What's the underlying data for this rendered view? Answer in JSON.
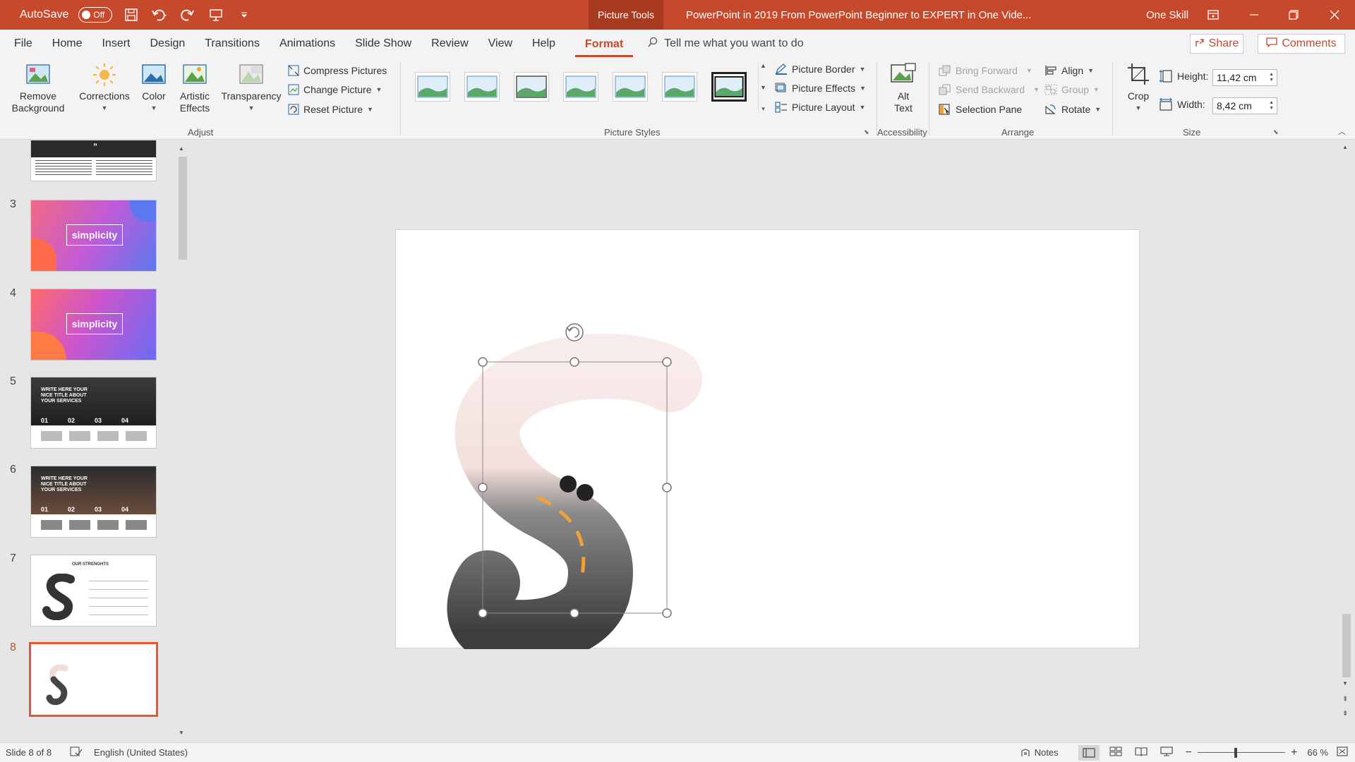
{
  "titlebar": {
    "autosave_label": "AutoSave",
    "autosave_state": "Off",
    "context_tab": "Picture Tools",
    "doc_title": "PowerPoint in 2019 From PowerPoint Beginner to EXPERT in One Vide...",
    "user": "One Skill"
  },
  "tabs": [
    "File",
    "Home",
    "Insert",
    "Design",
    "Transitions",
    "Animations",
    "Slide Show",
    "Review",
    "View",
    "Help",
    "Format"
  ],
  "active_tab": "Format",
  "tellme_placeholder": "Tell me what you want to do",
  "share_label": "Share",
  "comments_label": "Comments",
  "ribbon": {
    "adjust": {
      "label": "Adjust",
      "remove_bg": [
        "Remove",
        "Background"
      ],
      "corrections": "Corrections",
      "color": "Color",
      "artistic": [
        "Artistic",
        "Effects"
      ],
      "transparency": "Transparency",
      "compress": "Compress Pictures",
      "change": "Change Picture",
      "reset": "Reset Picture"
    },
    "picture_styles": {
      "label": "Picture Styles",
      "border": "Picture Border",
      "effects": "Picture Effects",
      "layout": "Picture Layout"
    },
    "accessibility": {
      "label": "Accessibility",
      "alt_text": [
        "Alt",
        "Text"
      ]
    },
    "arrange": {
      "label": "Arrange",
      "bring_forward": "Bring Forward",
      "send_backward": "Send Backward",
      "selection_pane": "Selection Pane",
      "align": "Align",
      "group": "Group",
      "rotate": "Rotate"
    },
    "size": {
      "label": "Size",
      "crop": "Crop",
      "height_label": "Height:",
      "height_value": "11,42 cm",
      "width_label": "Width:",
      "width_value": "8,42 cm"
    }
  },
  "slides": [
    {
      "num": "3",
      "title": "simplicity"
    },
    {
      "num": "4",
      "title": "simplicity"
    },
    {
      "num": "5",
      "title": "WRITE HERE YOUR NICE TITLE ABOUT YOUR SERVICES",
      "nums": [
        "01",
        "02",
        "03",
        "04"
      ]
    },
    {
      "num": "6",
      "title": "WRITE HERE YOUR NICE TITLE ABOUT YOUR SERVICES",
      "nums": [
        "01",
        "02",
        "03",
        "04"
      ]
    },
    {
      "num": "7",
      "title": "OUR STRENGHTS"
    },
    {
      "num": "8"
    }
  ],
  "status": {
    "slide_info": "Slide 8 of 8",
    "language": "English (United States)",
    "notes": "Notes",
    "zoom": "66 %"
  },
  "colors": {
    "accent": "#c5492a",
    "selected_thumb": "#e2573a"
  }
}
